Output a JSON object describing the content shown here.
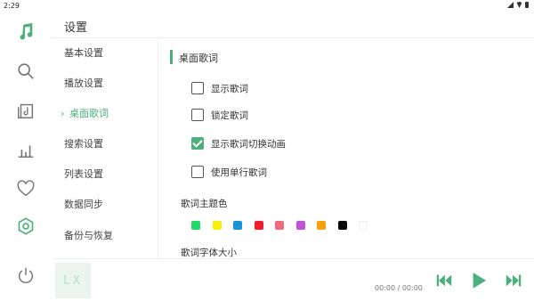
{
  "status_bar": {
    "time": "2:29"
  },
  "nav_rail": {
    "items": [
      {
        "icon": "music-note-icon",
        "active": true
      },
      {
        "icon": "search-icon"
      },
      {
        "icon": "music-list-icon"
      },
      {
        "icon": "chart-icon"
      },
      {
        "icon": "heart-icon"
      },
      {
        "icon": "settings-icon",
        "active": true
      },
      {
        "icon": "power-icon"
      }
    ]
  },
  "page": {
    "title": "设置"
  },
  "settings_menu": {
    "items": [
      {
        "label": "基本设置"
      },
      {
        "label": "播放设置"
      },
      {
        "label": "桌面歌词",
        "active": true
      },
      {
        "label": "搜索设置"
      },
      {
        "label": "列表设置"
      },
      {
        "label": "数据同步"
      },
      {
        "label": "备份与恢复"
      }
    ]
  },
  "section": {
    "title": "桌面歌词",
    "options": [
      {
        "label": "显示歌词",
        "checked": false
      },
      {
        "label": "锁定歌词",
        "checked": false
      },
      {
        "label": "显示歌词切换动画",
        "checked": true
      },
      {
        "label": "使用单行歌词",
        "checked": false
      }
    ],
    "theme_color_label": "歌词主题色",
    "theme_colors": [
      "#21d86a",
      "#f4f00a",
      "#1a92d8",
      "#f01c2a",
      "#f06a7e",
      "#c052d8",
      "#f5a00d",
      "#0a0a0a",
      "#ffffff"
    ],
    "font_size_label": "歌词字体大小"
  },
  "player": {
    "album_art_text": "LX",
    "time": "00:00 / 00:00"
  },
  "colors": {
    "accent": "#4daf7c",
    "icon": "#777777"
  }
}
